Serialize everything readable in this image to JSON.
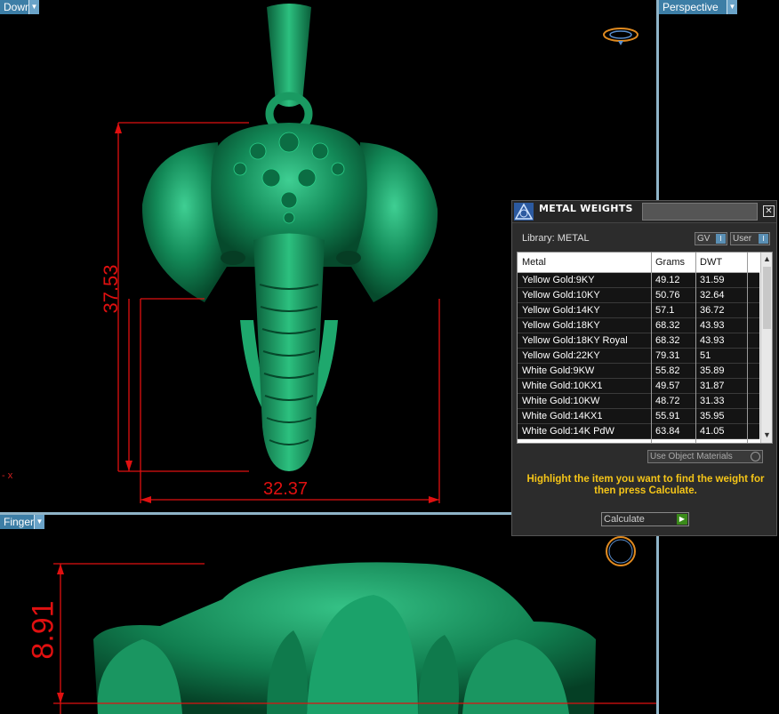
{
  "viewports": {
    "top_left_label": "Down",
    "top_right_label": "Perspective",
    "bottom_left_label": "Finger",
    "axis_label": "- x"
  },
  "dimensions": {
    "height": "37.53",
    "width": "32.37",
    "depth": "8.91"
  },
  "panel": {
    "title": "METAL WEIGHTS",
    "library_label": "Library: METAL",
    "gv_label": "GV",
    "user_label": "User",
    "columns": [
      "Metal",
      "Grams",
      "DWT"
    ],
    "rows": [
      {
        "metal": "Yellow Gold:9KY",
        "grams": "49.12",
        "dwt": "31.59"
      },
      {
        "metal": "Yellow Gold:10KY",
        "grams": "50.76",
        "dwt": "32.64"
      },
      {
        "metal": "Yellow Gold:14KY",
        "grams": "57.1",
        "dwt": "36.72"
      },
      {
        "metal": "Yellow Gold:18KY",
        "grams": "68.32",
        "dwt": "43.93"
      },
      {
        "metal": "Yellow Gold:18KY Royal",
        "grams": "68.32",
        "dwt": "43.93"
      },
      {
        "metal": "Yellow Gold:22KY",
        "grams": "79.31",
        "dwt": "51"
      },
      {
        "metal": "White Gold:9KW",
        "grams": "55.82",
        "dwt": "35.89"
      },
      {
        "metal": "White Gold:10KX1",
        "grams": "49.57",
        "dwt": "31.87"
      },
      {
        "metal": "White Gold:10KW",
        "grams": "48.72",
        "dwt": "31.33"
      },
      {
        "metal": "White Gold:14KX1",
        "grams": "55.91",
        "dwt": "35.95"
      },
      {
        "metal": "White Gold:14K PdW",
        "grams": "63.84",
        "dwt": "41.05"
      }
    ],
    "use_object_materials": "Use Object Materials",
    "instruction": "Highlight the item you want to find the weight for then press Calculate.",
    "calculate_label": "Calculate"
  },
  "colors": {
    "model_green": "#1a8a5a",
    "dimension_red": "#e01010",
    "viewport_label_blue": "#3d7ea6",
    "instruction_yellow": "#f5c518"
  }
}
